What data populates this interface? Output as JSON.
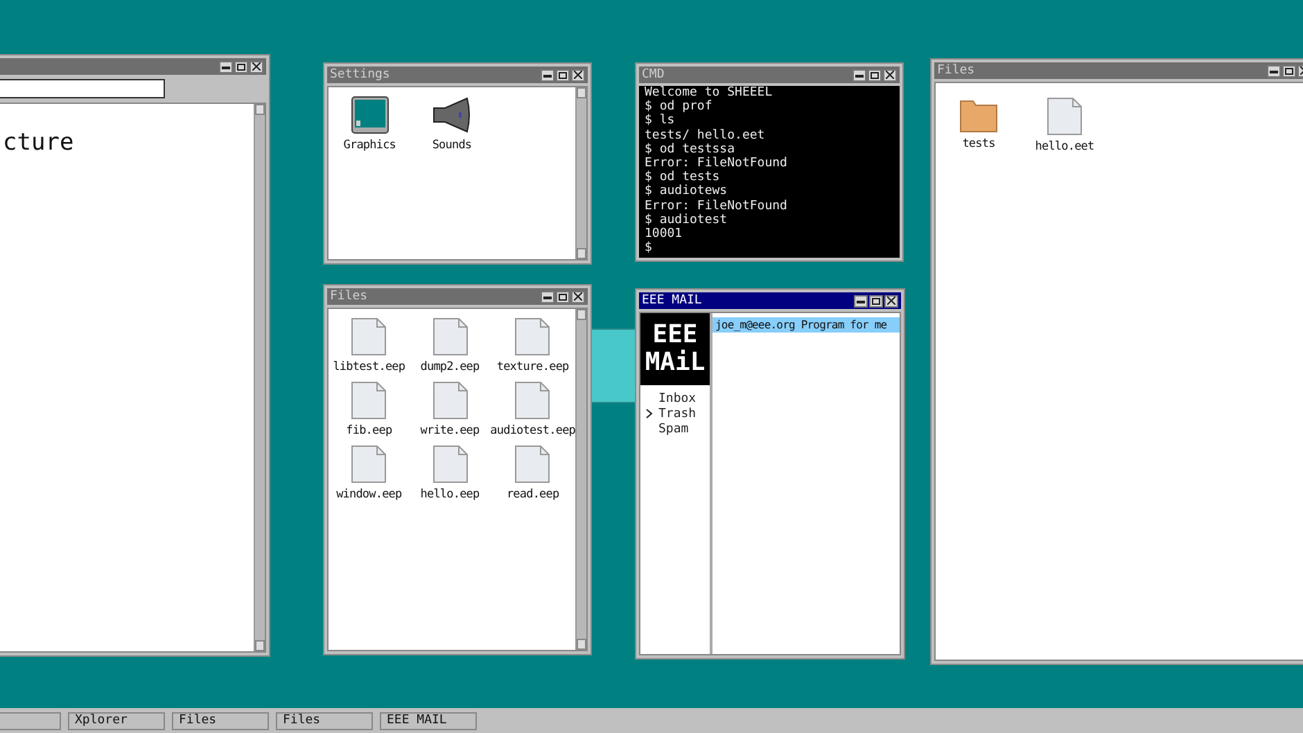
{
  "windows": [
    {
      "kind": "browser",
      "text": "cture"
    },
    {
      "kind": "icons",
      "title": "Settings",
      "items": [
        {
          "kind": "display",
          "label": "Graphics"
        },
        {
          "kind": "speaker",
          "label": "Sounds"
        }
      ]
    },
    {
      "kind": "terminal",
      "title": "CMD",
      "lines": [
        "Welcome to SHEEEL",
        "$ od prof",
        "$ ls",
        "tests/ hello.eet",
        "$ od testssa",
        "Error: FileNotFound",
        "$ od tests",
        "$ audiotews",
        "Error: FileNotFound",
        "$ audiotest",
        "10001",
        "$"
      ]
    },
    {
      "kind": "icons",
      "title": "Files",
      "items": [
        {
          "kind": "document",
          "label": "libtest.eep"
        },
        {
          "kind": "document",
          "label": "dump2.eep"
        },
        {
          "kind": "document",
          "label": "texture.eep"
        },
        {
          "kind": "document",
          "label": "fib.eep"
        },
        {
          "kind": "document",
          "label": "write.eep"
        },
        {
          "kind": "document",
          "label": "audiotest.eep"
        },
        {
          "kind": "document",
          "label": "window.eep"
        },
        {
          "kind": "document",
          "label": "hello.eep"
        },
        {
          "kind": "document",
          "label": "read.eep"
        }
      ]
    },
    {
      "kind": "mail",
      "title": "EEE MAIL",
      "logo": [
        "EEE",
        "MAiL"
      ],
      "folders": [
        {
          "label": "Inbox",
          "selected": false
        },
        {
          "label": "Trash",
          "selected": true
        },
        {
          "label": "Spam",
          "selected": false
        }
      ],
      "messages": [
        {
          "text": "joe_m@eee.org Program for me",
          "selected": true
        }
      ]
    },
    {
      "kind": "icons",
      "title": "Files",
      "items": [
        {
          "kind": "folder",
          "label": "tests"
        },
        {
          "kind": "document",
          "label": "hello.eet"
        }
      ]
    }
  ],
  "taskbar": [
    "Xplorer",
    "Files",
    "Files",
    "EEE MAIL"
  ]
}
